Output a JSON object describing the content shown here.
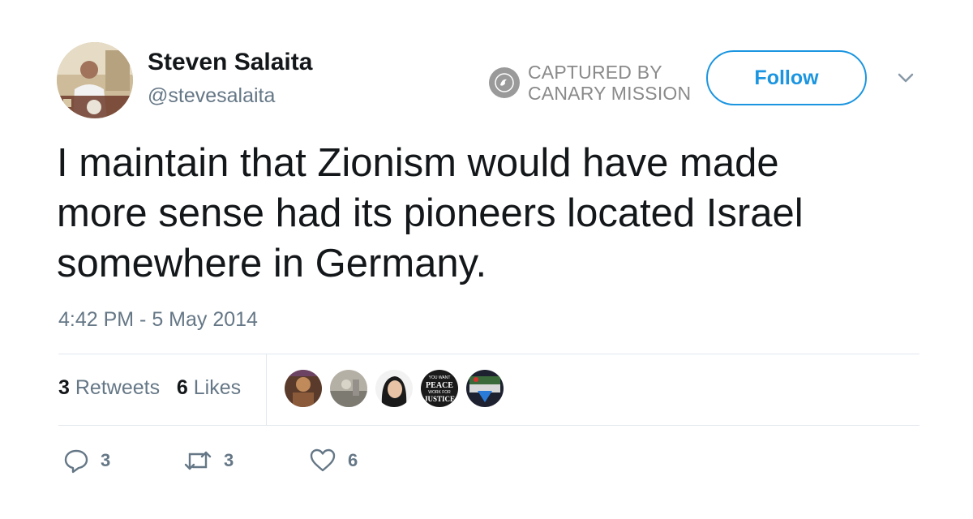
{
  "author": {
    "name": "Steven Salaita",
    "handle": "@stevesalaita",
    "avatar_icon": "profile-photo"
  },
  "watermark": {
    "line1": "CAPTURED BY",
    "line2": "CANARY MISSION",
    "icon": "canary-bird-icon"
  },
  "follow_button": {
    "label": "Follow",
    "color": "#1b95e0"
  },
  "tweet": {
    "line1": "I maintain that Zionism would have made",
    "line2": "more sense had its pioneers located Israel",
    "line3": "somewhere in Germany.",
    "timestamp": "4:42 PM - 5 May 2014"
  },
  "stats": {
    "retweets_count": "3",
    "retweets_label": "Retweets",
    "likes_count": "6",
    "likes_label": "Likes"
  },
  "liker_avatars": [
    "liker-avatar-1",
    "liker-avatar-2",
    "liker-avatar-3",
    "liker-avatar-4",
    "liker-avatar-5"
  ],
  "liker_badge_text": {
    "line1": "YOU WANT",
    "line2": "PEACE",
    "line3": "WORK FOR",
    "line4": "JUSTICE"
  },
  "actions": {
    "reply_count": "3",
    "retweet_count": "3",
    "like_count": "6"
  }
}
